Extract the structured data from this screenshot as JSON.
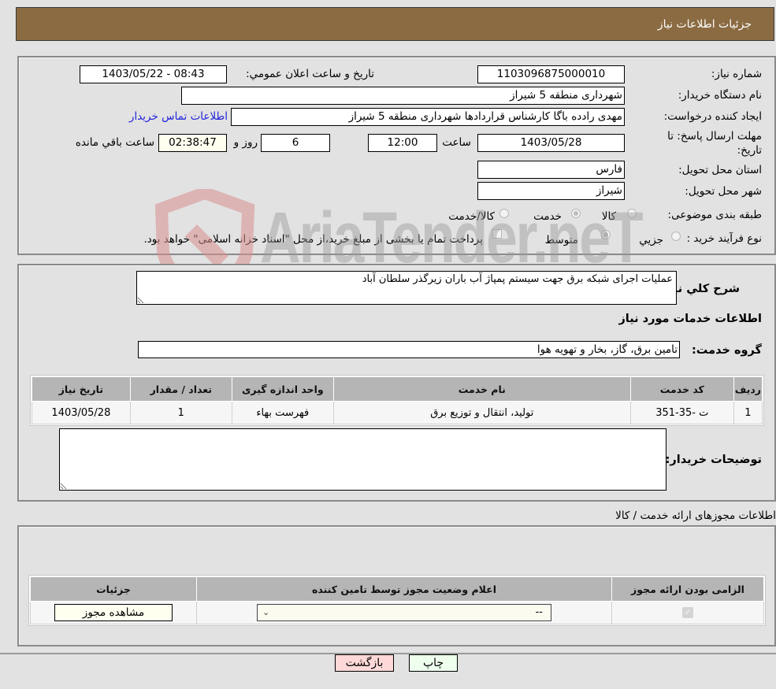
{
  "header": {
    "title": "جزئيات اطلاعات نياز"
  },
  "details": {
    "need_number_label": "شماره نياز:",
    "need_number": "1103096875000010",
    "announce_label": "تاريخ و ساعت اعلان عمومي:",
    "announce_value": "1403/05/22 - 08:43",
    "buyer_org_label": "نام دستگاه خريدار:",
    "buyer_org": "شهرداری منطقه 5 شیراز",
    "requester_label": "ايجاد کننده درخواست:",
    "requester": "مهدی رادده باگا کارشناس قراردادها شهرداری منطقه 5 شیراز",
    "contact_link": "اطلاعات تماس خريدار",
    "deadline_label": "مهلت ارسال پاسخ: تا تاريخ:",
    "deadline_date": "1403/05/28",
    "time_label": "ساعت",
    "deadline_time": "12:00",
    "days_value": "6",
    "days_label": "روز و",
    "remaining_time": "02:38:47",
    "remaining_label": "ساعت باقي مانده",
    "province_label": "استان محل تحويل:",
    "province": "فارس",
    "city_label": "شهر محل تحويل:",
    "city": "شیراز",
    "category_label": "طبقه بندی موضوعی:",
    "category_options": [
      {
        "label": "کالا",
        "selected": false
      },
      {
        "label": "خدمت",
        "selected": true
      },
      {
        "label": "کالا/خدمت",
        "selected": false
      }
    ],
    "process_label": "نوع فرآيند خريد :",
    "process_options": [
      {
        "label": "جزيي",
        "selected": false
      },
      {
        "label": "متوسط",
        "selected": true
      }
    ],
    "treasury_checkbox_label": "پرداخت تمام يا بخشی از مبلغ خريد،از محل \"اسناد خزانه اسلامی\" خواهد بود.",
    "treasury_checked": false
  },
  "services": {
    "description_label": "شرح کلي نياز:",
    "description": "عمليات اجرای شبکه برق جهت سيستم پمپاژ آب باران زيرگذر سلطان آباد",
    "section_title": "اطلاعات خدمات مورد نياز",
    "group_label": "گروه خدمت:",
    "group_value": "تامين برق، گاز، بخار و تهويه هوا",
    "table": {
      "headers": [
        "رديف",
        "کد خدمت",
        "نام خدمت",
        "واحد اندازه گيری",
        "تعداد / مقدار",
        "تاريخ نياز"
      ],
      "rows": [
        [
          "1",
          "ت -35-351",
          "توليد، انتقال و توزيع برق",
          "فهرست بهاء",
          "1",
          "1403/05/28"
        ]
      ]
    },
    "buyer_notes_label": "توضيحات خريدار:",
    "buyer_notes": ""
  },
  "permits": {
    "section_title": "اطلاعات مجوزهای ارائه خدمت / کالا",
    "headers": [
      "الزامی بودن ارائه مجوز",
      "اعلام وضعيت مجوز توسط تامين کننده",
      "جزئيات"
    ],
    "row": {
      "required_checked": true,
      "status_selected": "--",
      "details_button": "مشاهده مجوز"
    }
  },
  "footer": {
    "print_button": "چاپ",
    "back_button": "بازگشت"
  },
  "colors": {
    "header_bg": "#8b6b42",
    "print_bg": "#eeffee",
    "back_bg": "#ffd9d9"
  },
  "watermark": {
    "text": "AriaTender.neT"
  }
}
